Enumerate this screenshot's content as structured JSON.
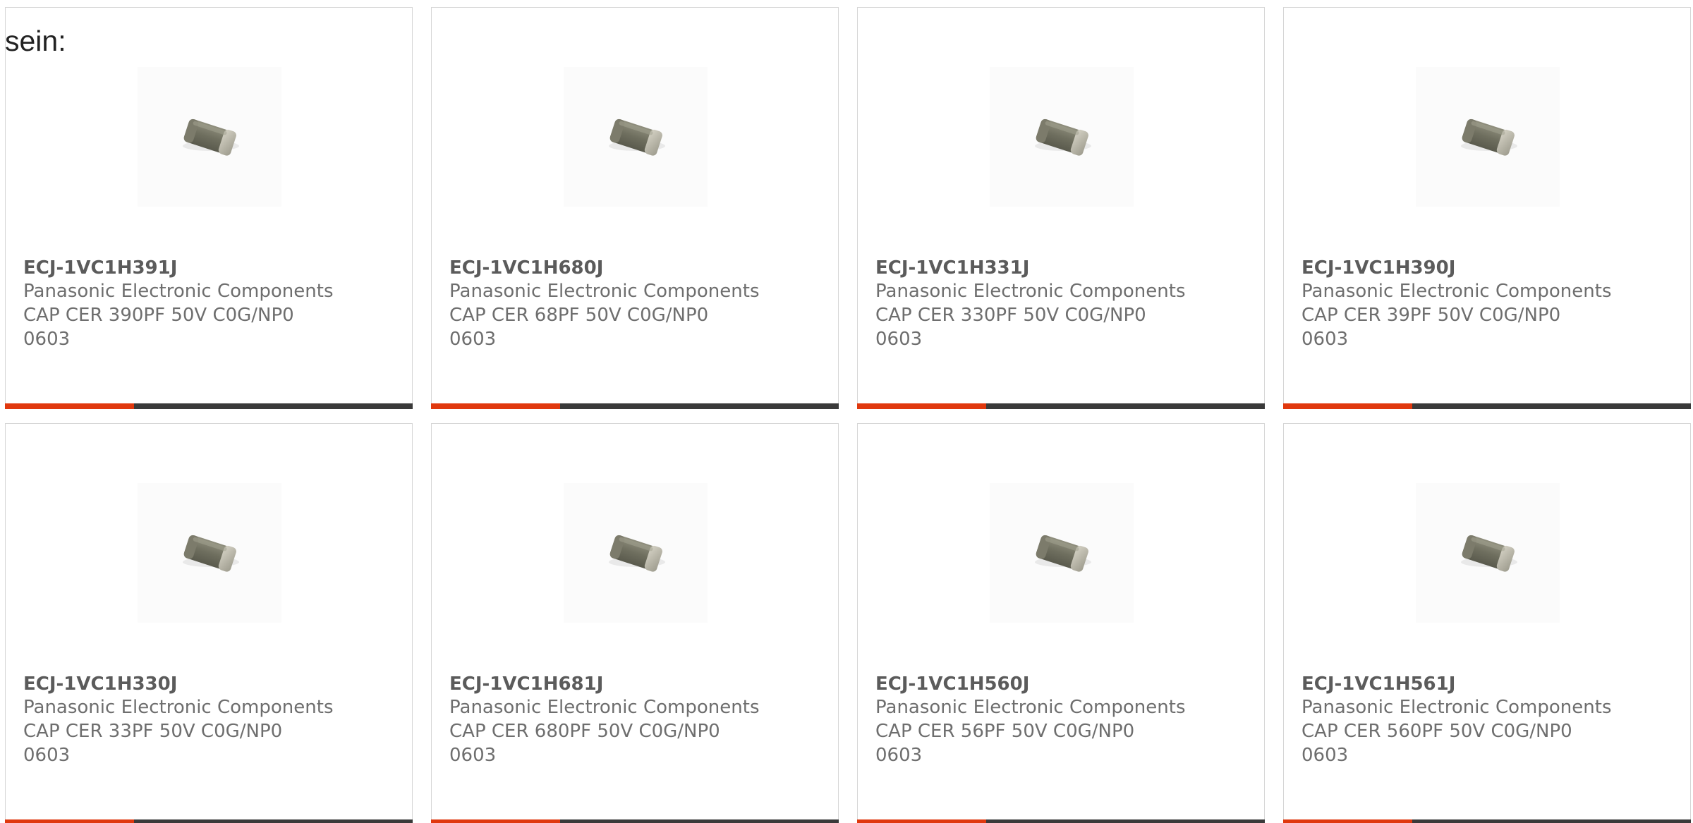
{
  "heading": "sein:",
  "colors": {
    "accent": "#e0380e",
    "bar": "#3a3a3a",
    "border": "#d6d6d6",
    "part_number": "#5b5b5b",
    "text": "#6e6e6e"
  },
  "products": [
    {
      "part_number": "ECJ-1VC1H391J",
      "manufacturer": "Panasonic Electronic Components",
      "description": "CAP CER 390PF 50V C0G/NP0",
      "package": "0603",
      "image": "ceramic-chip-capacitor-image"
    },
    {
      "part_number": "ECJ-1VC1H680J",
      "manufacturer": "Panasonic Electronic Components",
      "description": "CAP CER 68PF 50V C0G/NP0",
      "package": "0603",
      "image": "ceramic-chip-capacitor-image"
    },
    {
      "part_number": "ECJ-1VC1H331J",
      "manufacturer": "Panasonic Electronic Components",
      "description": "CAP CER 330PF 50V C0G/NP0",
      "package": "0603",
      "image": "ceramic-chip-capacitor-image"
    },
    {
      "part_number": "ECJ-1VC1H390J",
      "manufacturer": "Panasonic Electronic Components",
      "description": "CAP CER 39PF 50V C0G/NP0",
      "package": "0603",
      "image": "ceramic-chip-capacitor-image"
    },
    {
      "part_number": "ECJ-1VC1H330J",
      "manufacturer": "Panasonic Electronic Components",
      "description": "CAP CER 33PF 50V C0G/NP0",
      "package": "0603",
      "image": "ceramic-chip-capacitor-image"
    },
    {
      "part_number": "ECJ-1VC1H681J",
      "manufacturer": "Panasonic Electronic Components",
      "description": "CAP CER 680PF 50V C0G/NP0",
      "package": "0603",
      "image": "ceramic-chip-capacitor-image"
    },
    {
      "part_number": "ECJ-1VC1H560J",
      "manufacturer": "Panasonic Electronic Components",
      "description": "CAP CER 56PF 50V C0G/NP0",
      "package": "0603",
      "image": "ceramic-chip-capacitor-image"
    },
    {
      "part_number": "ECJ-1VC1H561J",
      "manufacturer": "Panasonic Electronic Components",
      "description": "CAP CER 560PF 50V C0G/NP0",
      "package": "0603",
      "image": "ceramic-chip-capacitor-image"
    }
  ]
}
